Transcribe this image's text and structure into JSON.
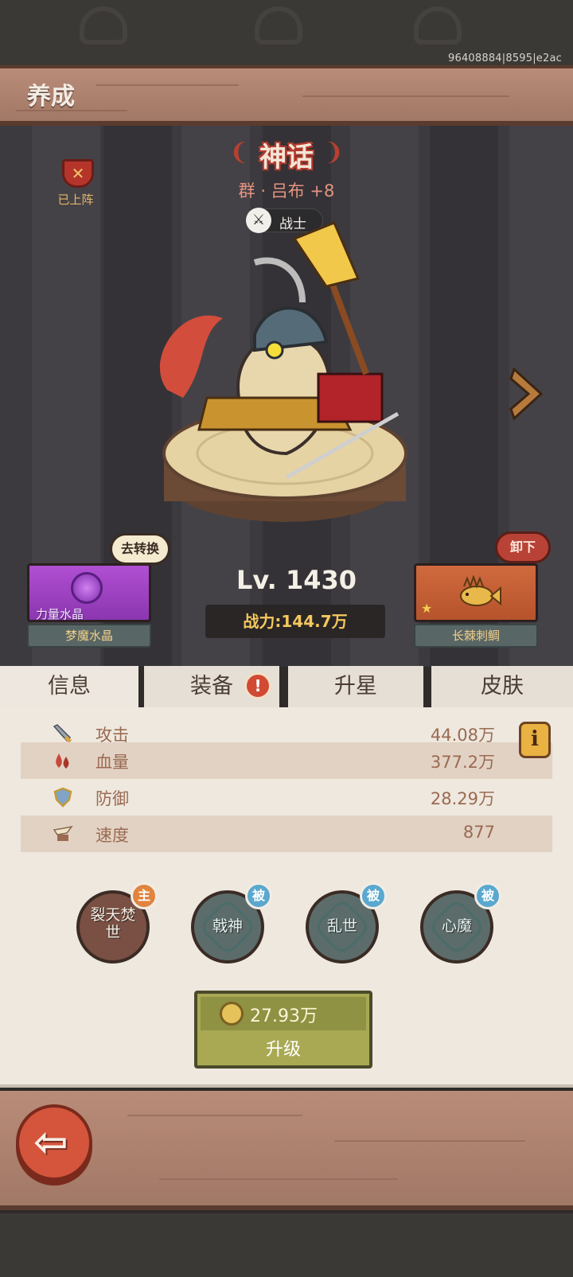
{
  "build_id": "96408884|8595|e2ac",
  "page_title": "养成",
  "deployed_label": "已上阵",
  "hero": {
    "rarity": "神话",
    "name": "群 · 吕布 +8",
    "class_label": "战士",
    "level": "Lv. 1430",
    "power": "战力:144.7万"
  },
  "left_item": {
    "type_label": "力量水晶",
    "name": "梦魔水晶",
    "action_label": "去转换"
  },
  "right_item": {
    "name": "长棘刺鲷",
    "action_label": "卸下"
  },
  "tabs": [
    {
      "label": "信息",
      "active": true
    },
    {
      "label": "装备",
      "active": false,
      "alert": "!"
    },
    {
      "label": "升星",
      "active": false
    },
    {
      "label": "皮肤",
      "active": false
    }
  ],
  "stats": [
    {
      "icon": "sword-icon",
      "label": "攻击",
      "value": "44.08万"
    },
    {
      "icon": "blood-drop-icon",
      "label": "血量",
      "value": "377.2万"
    },
    {
      "icon": "shield-icon",
      "label": "防御",
      "value": "28.29万"
    },
    {
      "icon": "wing-boot-icon",
      "label": "速度",
      "value": "877"
    }
  ],
  "info_button_label": "i",
  "skills": [
    {
      "name": "裂天焚世",
      "tag": "主",
      "kind": "active"
    },
    {
      "name": "戟神",
      "tag": "被",
      "kind": "passive"
    },
    {
      "name": "乱世",
      "tag": "被",
      "kind": "passive"
    },
    {
      "name": "心魔",
      "tag": "被",
      "kind": "passive"
    }
  ],
  "upgrade": {
    "cost": "27.93万",
    "label": "升级"
  },
  "colors": {
    "wood": "#b88c78",
    "rarity_red": "#b33a2d",
    "gold": "#f5c85e",
    "upgrade_green": "#a9a954",
    "back_button": "#d4553c"
  }
}
